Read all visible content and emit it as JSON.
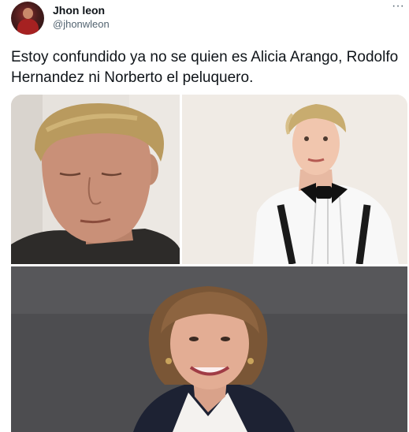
{
  "author": {
    "name": "Jhon leon",
    "handle": "@jhonwleon"
  },
  "menu": {
    "more_label": "···"
  },
  "tweet": {
    "text": "Estoy confundido ya no se quien es Alicia Arango, Rodolfo Hernandez ni Norberto el peluquero."
  },
  "media": {
    "photos": [
      {
        "icon": "photo-man-blond-hair"
      },
      {
        "icon": "photo-man-tuxedo-bowtie"
      },
      {
        "icon": "photo-woman-bob-haircut"
      }
    ]
  },
  "colors": {
    "text": "#0f1419",
    "secondary": "#536471",
    "background": "#ffffff"
  }
}
